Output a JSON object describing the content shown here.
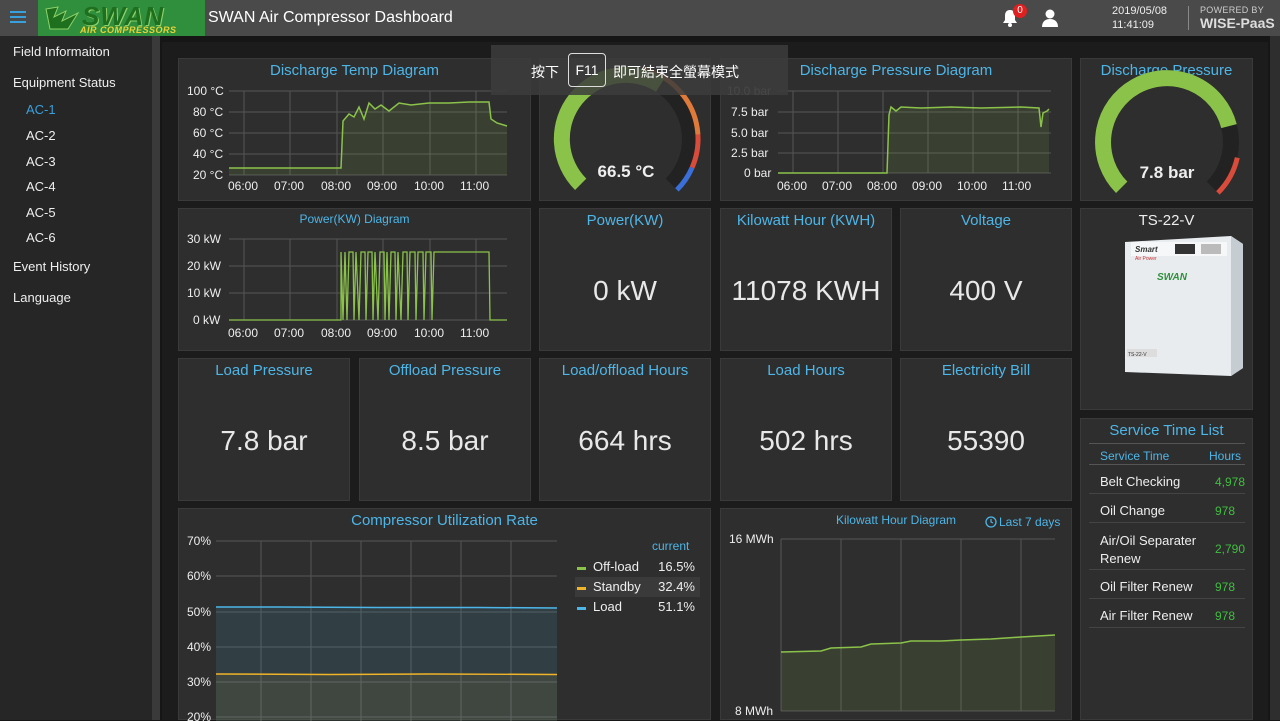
{
  "header": {
    "app_title": "SWAN Air Compressor Dashboard",
    "logo_text": "SWAN",
    "logo_subtext": "AIR COMPRESSORS",
    "notification_count": "0",
    "date": "2019/05/08",
    "time": "11:41:09",
    "powered_by": "POWERED BY",
    "brand": "WISE-PaaS"
  },
  "sidebar": {
    "field_information": "Field Informaiton",
    "equipment_status": "Equipment Status",
    "units": [
      "AC-1",
      "AC-2",
      "AC-3",
      "AC-4",
      "AC-5",
      "AC-6"
    ],
    "active_unit": "AC-1",
    "event_history": "Event History",
    "language": "Language"
  },
  "toast": {
    "before_key": "按下",
    "key": "F11",
    "after_key": "即可結束全螢幕模式"
  },
  "discharge_temp": {
    "title": "Discharge Temp Diagram",
    "y_ticks": [
      "100 °C",
      "80 °C",
      "60 °C",
      "40 °C",
      "20 °C"
    ],
    "x_ticks": [
      "06:00",
      "07:00",
      "08:00",
      "09:00",
      "10:00",
      "11:00"
    ]
  },
  "temp_gauge": {
    "value": "66.5 °C",
    "fraction": 0.62
  },
  "discharge_pressure_diagram": {
    "title": "Discharge Pressure Diagram",
    "y_ticks": [
      "10.0 bar",
      "7.5 bar",
      "5.0 bar",
      "2.5 bar",
      "0 bar"
    ],
    "x_ticks": [
      "06:00",
      "07:00",
      "08:00",
      "09:00",
      "10:00",
      "11:00"
    ]
  },
  "discharge_pressure_gauge": {
    "title": "Discharge Pressure",
    "value": "7.8 bar",
    "fraction": 0.78
  },
  "power_diagram": {
    "title": "Power(KW) Diagram",
    "y_ticks": [
      "30 kW",
      "20 kW",
      "10 kW",
      "0 kW"
    ],
    "x_ticks": [
      "06:00",
      "07:00",
      "08:00",
      "09:00",
      "10:00",
      "11:00"
    ]
  },
  "power": {
    "title": "Power(KW)",
    "value": "0 kW"
  },
  "kwh": {
    "title": "Kilowatt Hour (KWH)",
    "value": "11078 KWH"
  },
  "voltage": {
    "title": "Voltage",
    "value": "400 V"
  },
  "model": {
    "name": "TS-22-V",
    "machine_brand": "SWAN",
    "machine_series": "Smart",
    "machine_tagline": "Air Power",
    "machine_model_tag": "TS-22-V"
  },
  "load_pressure": {
    "title": "Load Pressure",
    "value": "7.8 bar"
  },
  "offload_pressure": {
    "title": "Offload Pressure",
    "value": "8.5 bar"
  },
  "load_offload_hours": {
    "title": "Load/offload Hours",
    "value": "664 hrs"
  },
  "load_hours": {
    "title": "Load Hours",
    "value": "502 hrs"
  },
  "electricity_bill": {
    "title": "Electricity Bill",
    "value": "55390"
  },
  "service": {
    "title": "Service Time List",
    "col_service": "Service Time",
    "col_hours": "Hours",
    "rows": [
      {
        "name": "Belt Checking",
        "hours": "4,978"
      },
      {
        "name": "Oil Change",
        "hours": "978"
      },
      {
        "name": "Air/Oil Separater Renew",
        "hours": "2,790"
      },
      {
        "name": "Oil Filter Renew",
        "hours": "978"
      },
      {
        "name": "Air Filter Renew",
        "hours": "978"
      }
    ]
  },
  "utilization": {
    "title": "Compressor Utilization Rate",
    "y_ticks": [
      "70%",
      "60%",
      "50%",
      "40%",
      "30%",
      "20%"
    ],
    "legend_header": "current",
    "legend": [
      {
        "name": "Off-load",
        "value": "16.5%",
        "color": "#8bc34a"
      },
      {
        "name": "Standby",
        "value": "32.4%",
        "color": "#f0b429"
      },
      {
        "name": "Load",
        "value": "51.1%",
        "color": "#4db6e8"
      }
    ]
  },
  "kwh_diagram": {
    "title": "Kilowatt Hour Diagram",
    "range": "Last 7 days",
    "y_top": "16 MWh",
    "y_bottom": "8 MWh"
  },
  "colors": {
    "accent": "#4db6e8",
    "chart_line": "#8bc34a",
    "panel": "#2e2e2e"
  }
}
